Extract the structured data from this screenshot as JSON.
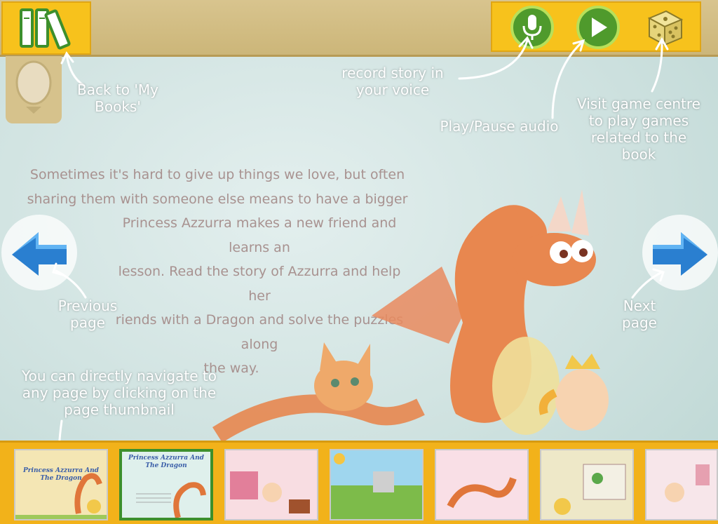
{
  "story": {
    "lines": [
      "Sometimes it's hard to give up things we love, but often",
      "sharing them with someone else means to have a bigger",
      "Princess Azzurra makes a new friend and learns an",
      "lesson. Read the story of Azzurra and help her",
      "riends with a Dragon and solve the puzzles along",
      "the way."
    ]
  },
  "annotations": {
    "back": "Back to 'My Books'",
    "record": "record story in your voice",
    "play": "Play/Pause audio",
    "game": "Visit game centre to play games related to the book",
    "prev": "Previous page",
    "next": "Next page",
    "thumbs": "You can directly navigate to any page by clicking on the page thumbnail"
  },
  "thumbnails": [
    {
      "title": "Princess Azzurra And The Dragon",
      "text": "",
      "bg": "#f4e6b4"
    },
    {
      "title": "Princess Azzurra And The Dragon",
      "text": "Sometimes it's hard to give up things we love",
      "bg": "#dff0ec"
    },
    {
      "title": "",
      "text": "",
      "bg": "#f8dde2"
    },
    {
      "title": "",
      "text": "",
      "bg": "#9fd6ee"
    },
    {
      "title": "",
      "text": "",
      "bg": "#f9dfe6"
    },
    {
      "title": "",
      "text": "",
      "bg": "#eee8c8"
    },
    {
      "title": "",
      "text": "",
      "bg": "#f7e6ea"
    }
  ],
  "colors": {
    "accent": "#f7c21c",
    "button_green": "#4f9a2c",
    "nav_blue": "#2a7fd0"
  },
  "icons": {
    "books": "books-icon",
    "mic": "microphone-icon",
    "play": "play-icon",
    "dice": "dice-icon",
    "acorn": "acorn-icon",
    "prev": "arrow-left-icon",
    "next": "arrow-right-icon"
  }
}
